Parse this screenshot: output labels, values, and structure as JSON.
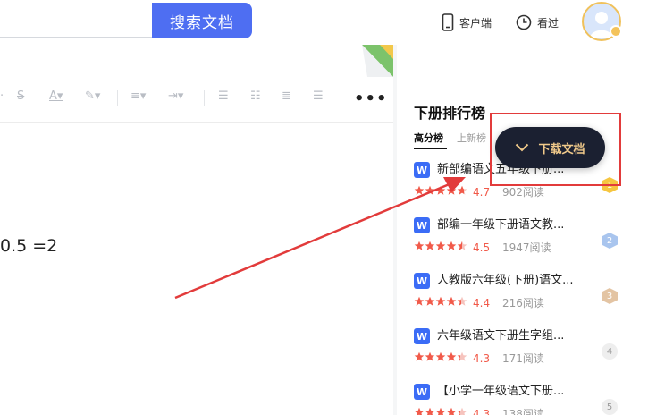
{
  "header": {
    "search_button_label": "搜索文档",
    "client_label": "客户端",
    "history_label": "看过"
  },
  "document": {
    "visible_text": "0.5 =2",
    "toolbar_icons": [
      "strikethrough-icon",
      "font-color-icon",
      "highlight-icon",
      "align-icon",
      "indent-icon",
      "ordered-list-icon",
      "bullet-list-icon",
      "align-center-icon",
      "line-spacing-icon"
    ],
    "more_label": "•••"
  },
  "sidebar": {
    "title": "下册排行榜",
    "tabs": [
      {
        "label": "高分榜",
        "active": true
      },
      {
        "label": "上新榜",
        "active": false
      }
    ],
    "items": [
      {
        "title": "新部编语文五年级下册...",
        "score": "4.7",
        "reads": "902阅读",
        "rank": "1",
        "rating": 4.7
      },
      {
        "title": "部编一年级下册语文教...",
        "score": "4.5",
        "reads": "1947阅读",
        "rank": "2",
        "rating": 4.5
      },
      {
        "title": "人教版六年级(下册)语文...",
        "score": "4.4",
        "reads": "216阅读",
        "rank": "3",
        "rating": 4.4
      },
      {
        "title": "六年级语文下册生字组...",
        "score": "4.3",
        "reads": "171阅读",
        "rank": "4",
        "rating": 4.3
      },
      {
        "title": "【小学一年级语文下册...",
        "score": "4.3",
        "reads": "138阅读",
        "rank": "5",
        "rating": 4.3
      }
    ]
  },
  "download_button": {
    "label": "下载文档"
  },
  "colors": {
    "primary": "#4e6ef2",
    "download_bg": "#1b2031",
    "download_text": "#f0c98a",
    "star": "#f15a4a",
    "annotation": "#e23b3b"
  }
}
